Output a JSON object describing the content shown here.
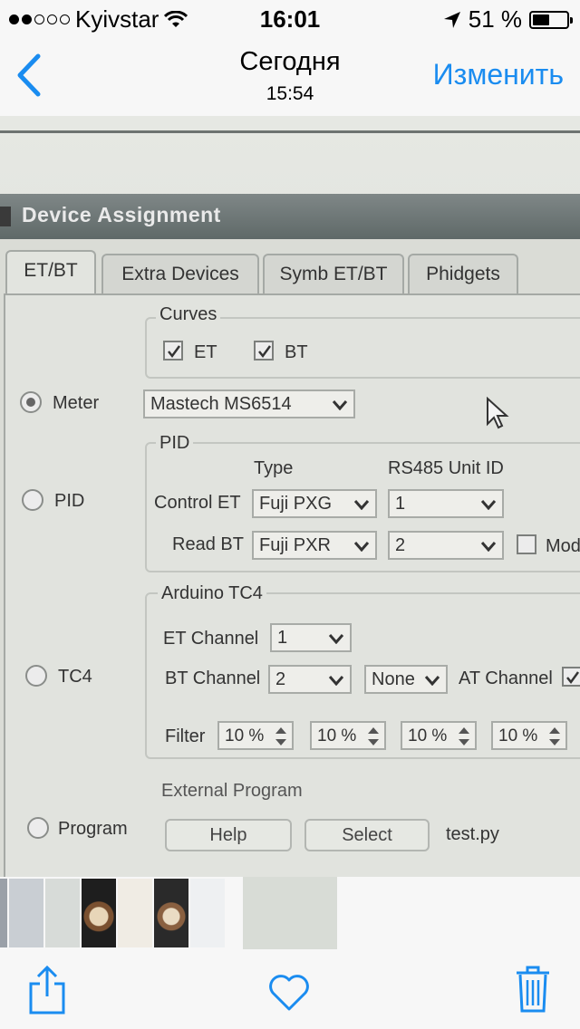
{
  "status_bar": {
    "carrier": "Kyivstar",
    "time": "16:01",
    "battery": "51 %",
    "battery_level": 0.51
  },
  "nav": {
    "title": "Сегодня",
    "subtitle": "15:54",
    "edit_label": "Изменить"
  },
  "dialog": {
    "title": "Device Assignment",
    "tabs": [
      "ET/BT",
      "Extra Devices",
      "Symb ET/BT",
      "Phidgets"
    ],
    "curves": {
      "label": "Curves",
      "et": "ET",
      "bt": "BT"
    },
    "radios": {
      "meter": "Meter",
      "pid": "PID",
      "tc4": "TC4",
      "program": "Program"
    },
    "meter_value": "Mastech MS6514",
    "pid": {
      "label": "PID",
      "type_header": "Type",
      "unit_header": "RS485 Unit ID",
      "control_label": "Control ET",
      "control_type": "Fuji PXG",
      "control_unit": "1",
      "read_label": "Read BT",
      "read_type": "Fuji PXR",
      "read_unit": "2",
      "mod_label": "Mod"
    },
    "tc4": {
      "label": "Arduino TC4",
      "et_channel_label": "ET Channel",
      "et_channel": "1",
      "bt_channel_label": "BT Channel",
      "bt_channel": "2",
      "none_value": "None",
      "at_channel_label": "AT Channel",
      "filter_label": "Filter",
      "filters": [
        "10 %",
        "10 %",
        "10 %",
        "10 %"
      ]
    },
    "external": {
      "label": "External Program",
      "help": "Help",
      "select": "Select",
      "file": "test.py"
    }
  },
  "icons": [
    "wifi-icon",
    "location-arrow-icon",
    "back-chevron-icon",
    "share-icon",
    "heart-icon",
    "trash-icon"
  ],
  "colors": {
    "ios_blue": "#1a8cf0",
    "titlebar": "#6a7372"
  }
}
